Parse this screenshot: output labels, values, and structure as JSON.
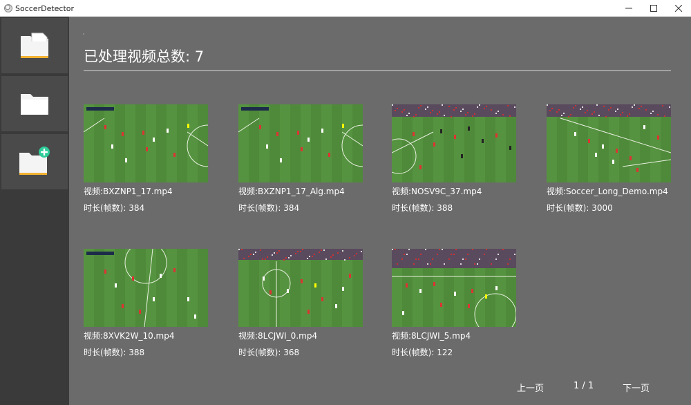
{
  "window": {
    "title": "SoccerDetector",
    "minimize_icon": "minimize-icon",
    "maximize_icon": "maximize-icon",
    "close_icon": "close-icon"
  },
  "sidebar": {
    "items": [
      {
        "icon": "open-file-folder-icon"
      },
      {
        "icon": "folder-icon"
      },
      {
        "icon": "add-folder-icon"
      }
    ],
    "accent_color": "#2ecc9a",
    "folder_stripe_color": "#f2b233"
  },
  "main": {
    "heading": "已处理视频总数: 7",
    "videos": [
      {
        "name": "视频:BXZNP1_17.mp4",
        "duration": "时长(帧数): 384"
      },
      {
        "name": "视频:BXZNP1_17_Alg.mp4",
        "duration": "时长(帧数): 384"
      },
      {
        "name": "视频:NOSV9C_37.mp4",
        "duration": "时长(帧数): 388"
      },
      {
        "name": "视频:Soccer_Long_Demo.mp4",
        "duration": "时长(帧数): 3000"
      },
      {
        "name": "视频:8XVK2W_10.mp4",
        "duration": "时长(帧数): 388"
      },
      {
        "name": "视频:8LCJWI_0.mp4",
        "duration": "时长(帧数): 368"
      },
      {
        "name": "视频:8LCJWI_5.mp4",
        "duration": "时长(帧数): 122"
      }
    ]
  },
  "pagination": {
    "prev": "上一页",
    "page_info": "1 / 1",
    "next": "下一页"
  },
  "colors": {
    "background": "#6b6b6b",
    "sidebar": "#3a3a3a",
    "sidebar_button": "#4a4a4a",
    "pitch": "#4f8a3a",
    "pitch_light": "#5c9a44"
  }
}
